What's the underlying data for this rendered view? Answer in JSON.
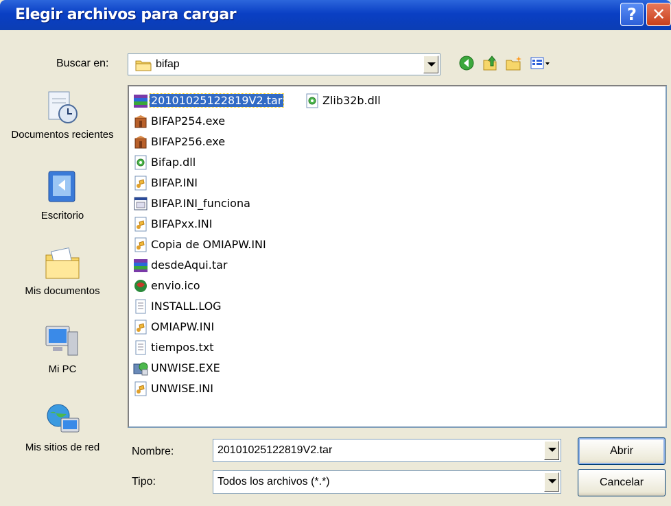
{
  "window": {
    "title": "Elegir archivos para cargar"
  },
  "lookin": {
    "label": "Buscar en:",
    "value": "bifap"
  },
  "places": [
    {
      "label": "Documentos recientes",
      "icon": "recent-documents-icon"
    },
    {
      "label": "Escritorio",
      "icon": "desktop-icon"
    },
    {
      "label": "Mis documentos",
      "icon": "my-documents-icon"
    },
    {
      "label": "Mi PC",
      "icon": "my-computer-icon"
    },
    {
      "label": "Mis sitios de red",
      "icon": "network-places-icon"
    }
  ],
  "files": {
    "col1": [
      {
        "name": "20101025122819V2.tar",
        "icon": "archive-icon",
        "selected": true
      },
      {
        "name": "BIFAP254.exe",
        "icon": "installer-icon"
      },
      {
        "name": "BIFAP256.exe",
        "icon": "installer-icon"
      },
      {
        "name": "Bifap.dll",
        "icon": "dll-icon"
      },
      {
        "name": "BIFAP.INI",
        "icon": "ini-icon"
      },
      {
        "name": "BIFAP.INI_funciona",
        "icon": "generic-file-icon"
      },
      {
        "name": "BIFAPxx.INI",
        "icon": "ini-icon"
      },
      {
        "name": "Copia de OMIAPW.INI",
        "icon": "ini-icon"
      },
      {
        "name": "desdeAqui.tar",
        "icon": "archive-icon"
      },
      {
        "name": "envio.ico",
        "icon": "ico-icon"
      },
      {
        "name": "INSTALL.LOG",
        "icon": "text-file-icon"
      },
      {
        "name": "OMIAPW.INI",
        "icon": "ini-icon"
      },
      {
        "name": "tiempos.txt",
        "icon": "text-file-icon"
      },
      {
        "name": "UNWISE.EXE",
        "icon": "uninstall-icon"
      },
      {
        "name": "UNWISE.INI",
        "icon": "ini-icon"
      }
    ],
    "col2": [
      {
        "name": "Zlib32b.dll",
        "icon": "dll-icon"
      }
    ]
  },
  "filename": {
    "label": "Nombre:",
    "value": "20101025122819V2.tar"
  },
  "filetype": {
    "label": "Tipo:",
    "value": "Todos los archivos (*.*)"
  },
  "buttons": {
    "open": "Abrir",
    "cancel": "Cancelar"
  },
  "colors": {
    "titlebar": "#0a3fc4",
    "selection": "#316ac5",
    "dialog_bg": "#ece9d8"
  }
}
